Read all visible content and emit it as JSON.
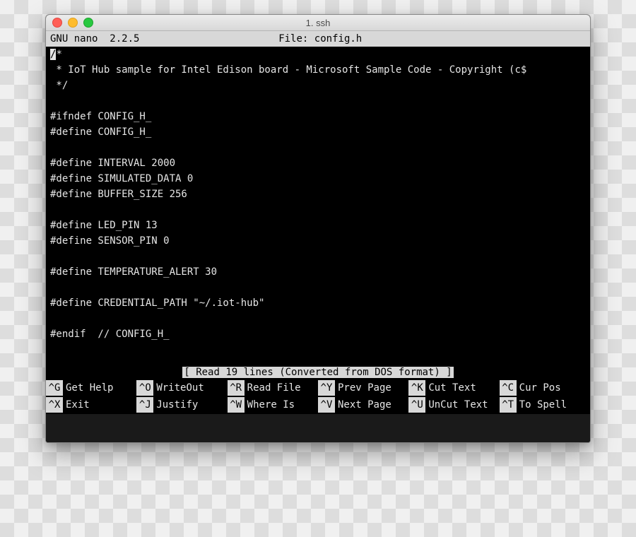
{
  "window": {
    "title": "1. ssh"
  },
  "nano": {
    "app": "GNU nano",
    "version": "2.2.5",
    "file_label": "File:",
    "filename": "config.h"
  },
  "editor": {
    "cursor_char": "/",
    "lines": [
      "*",
      " * IoT Hub sample for Intel Edison board - Microsoft Sample Code - Copyright (c$",
      " */",
      "",
      "#ifndef CONFIG_H_",
      "#define CONFIG_H_",
      "",
      "#define INTERVAL 2000",
      "#define SIMULATED_DATA 0",
      "#define BUFFER_SIZE 256",
      "",
      "#define LED_PIN 13",
      "#define SENSOR_PIN 0",
      "",
      "#define TEMPERATURE_ALERT 30",
      "",
      "#define CREDENTIAL_PATH \"~/.iot-hub\"",
      "",
      "#endif  // CONFIG_H_",
      ""
    ]
  },
  "status": "[ Read 19 lines (Converted from DOS format) ]",
  "shortcuts": {
    "row1": [
      {
        "key": "^G",
        "label": "Get Help"
      },
      {
        "key": "^O",
        "label": "WriteOut"
      },
      {
        "key": "^R",
        "label": "Read File"
      },
      {
        "key": "^Y",
        "label": "Prev Page"
      },
      {
        "key": "^K",
        "label": "Cut Text"
      },
      {
        "key": "^C",
        "label": "Cur Pos"
      }
    ],
    "row2": [
      {
        "key": "^X",
        "label": "Exit"
      },
      {
        "key": "^J",
        "label": "Justify"
      },
      {
        "key": "^W",
        "label": "Where Is"
      },
      {
        "key": "^V",
        "label": "Next Page"
      },
      {
        "key": "^U",
        "label": "UnCut Text"
      },
      {
        "key": "^T",
        "label": "To Spell"
      }
    ]
  }
}
